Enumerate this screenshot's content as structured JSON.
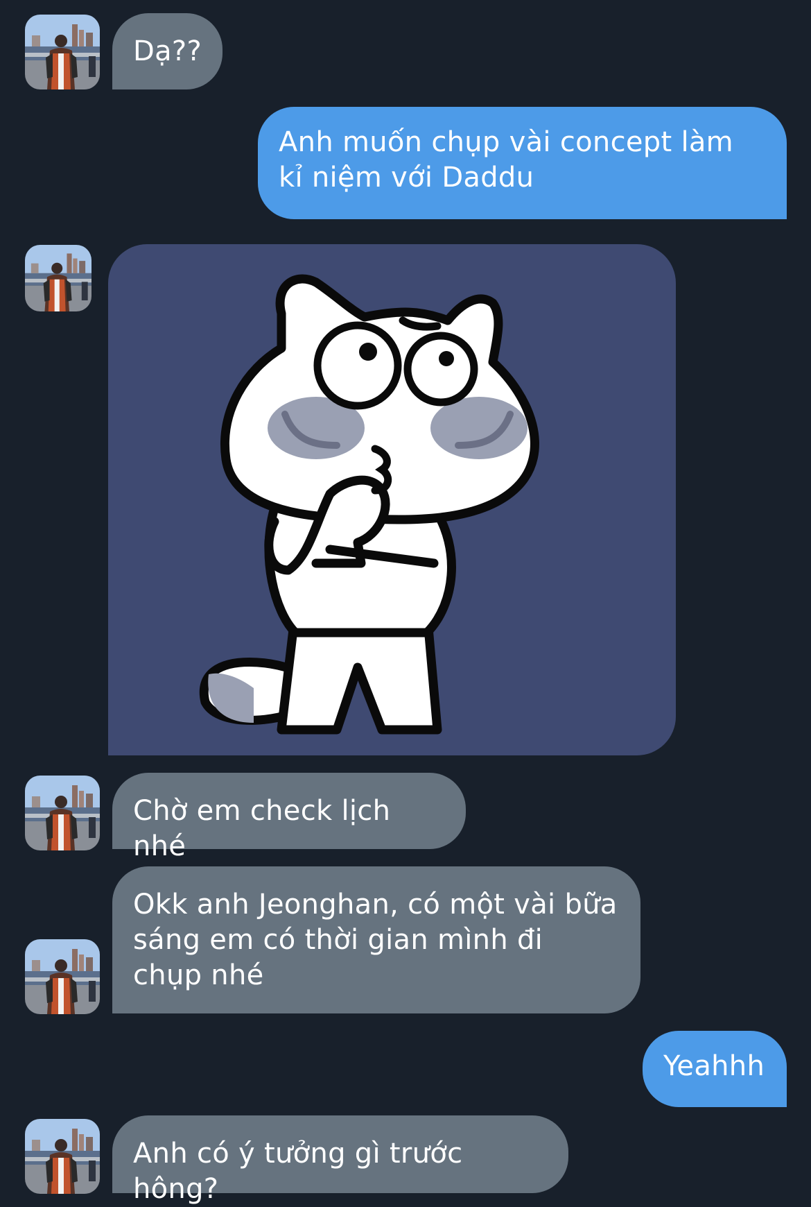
{
  "conversation": {
    "messages": [
      {
        "sender": "other",
        "text": "Dạ??"
      },
      {
        "sender": "me",
        "text": "Anh muốn chụp vài concept làm kỉ niệm với Daddu"
      },
      {
        "sender": "other",
        "type": "sticker",
        "sticker": "thinking-white-cat-sticker"
      },
      {
        "sender": "other",
        "text": "Chờ em check lịch nhé"
      },
      {
        "sender": "other",
        "text": "Okk anh Jeonghan, có một vài bữa sáng em có thời gian mình đi chụp nhé"
      },
      {
        "sender": "me",
        "text": "Yeahhh"
      },
      {
        "sender": "other",
        "text": "Anh có ý tưởng gì trước hông?"
      }
    ]
  },
  "colors": {
    "background": "#18202b",
    "incoming_bubble": "#66737f",
    "outgoing_bubble": "#4d9be8",
    "sticker_background": "#3f4a72"
  }
}
